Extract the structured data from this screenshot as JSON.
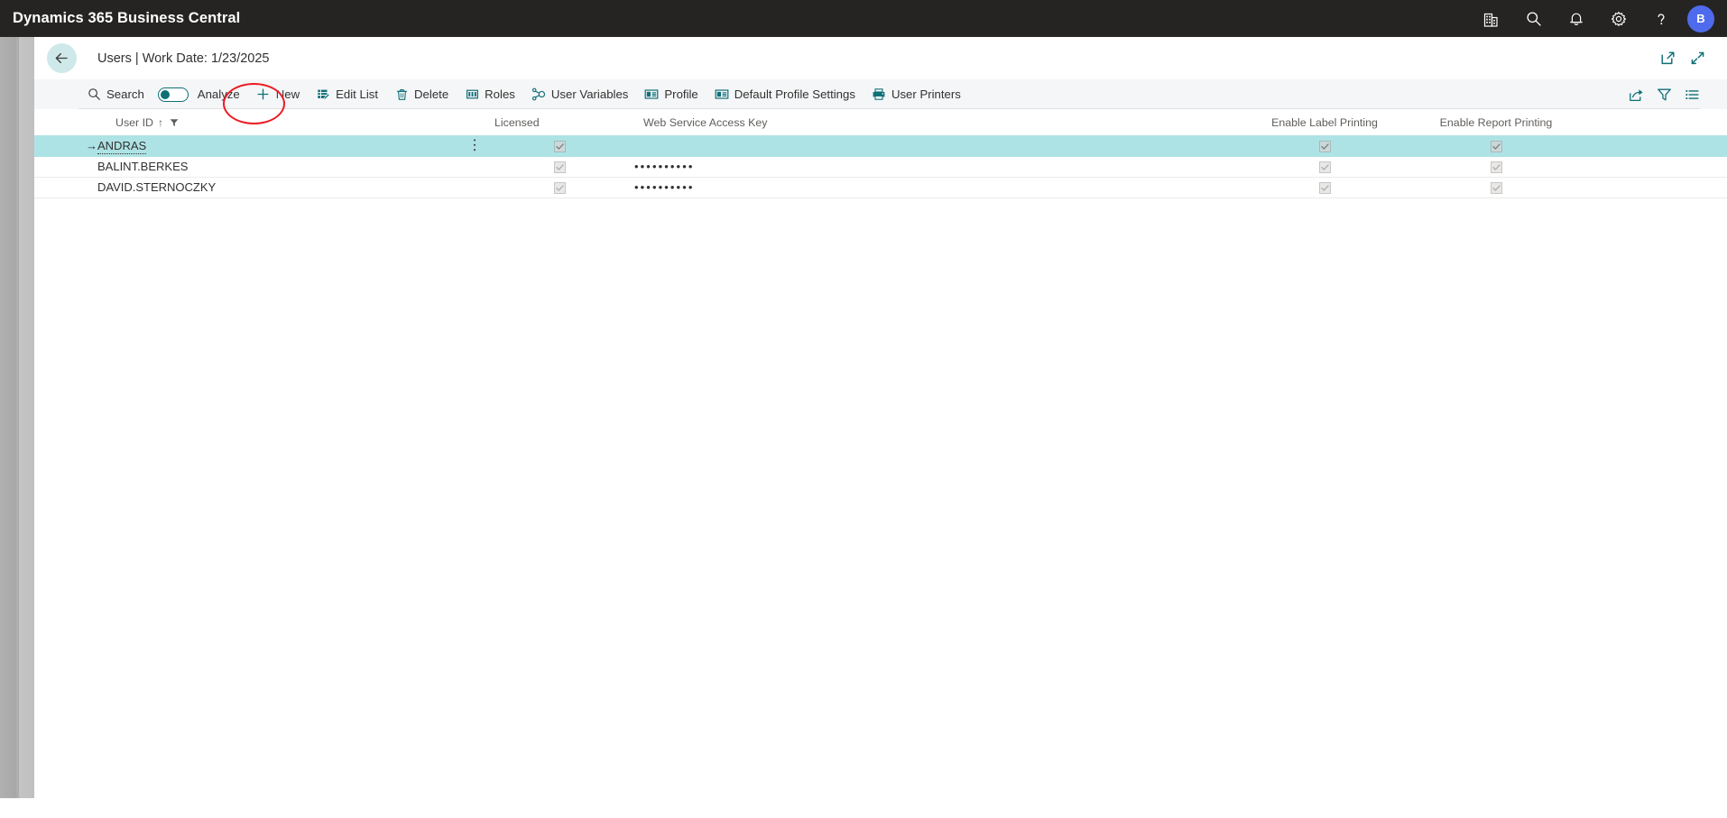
{
  "appbar": {
    "title": "Dynamics 365 Business Central",
    "icons": [
      {
        "name": "company-icon",
        "label": "Company"
      },
      {
        "name": "search-icon",
        "label": "Search"
      },
      {
        "name": "notification-bell-icon",
        "label": "Notifications"
      },
      {
        "name": "gear-icon",
        "label": "Settings"
      },
      {
        "name": "help-icon",
        "label": "Help"
      }
    ],
    "avatar_initial": "B",
    "avatar_color": "#4f6bed",
    "background": "#252423"
  },
  "page_header": {
    "back_label": "Back",
    "title": "Users | Work Date: 1/23/2025",
    "open_new_window_label": "Open in new window",
    "collapse_label": "Collapse"
  },
  "command_bar": {
    "search_label": "Search",
    "analyze_label": "Analyze",
    "analyze_toggle_on": false,
    "new_label": "New",
    "edit_list_label": "Edit List",
    "delete_label": "Delete",
    "roles_label": "Roles",
    "user_variables_label": "User Variables",
    "profile_label": "Profile",
    "default_profile_settings_label": "Default Profile Settings",
    "user_printers_label": "User Printers",
    "share_label": "Share",
    "filter_label": "Filter",
    "view_options_label": "View options",
    "accent_color": "#0f7078"
  },
  "annotation": {
    "target": "New",
    "shape": "ellipse",
    "color": "#ec1c24"
  },
  "table": {
    "columns": [
      {
        "key": "indicator",
        "label": ""
      },
      {
        "key": "user_id",
        "label": "User ID"
      },
      {
        "key": "licensed",
        "label": "Licensed"
      },
      {
        "key": "web_service_access_key",
        "label": "Web Service Access Key"
      },
      {
        "key": "enable_label_printing",
        "label": "Enable Label Printing"
      },
      {
        "key": "enable_report_printing",
        "label": "Enable Report Printing"
      }
    ],
    "sort_column": "User ID",
    "sort_direction": "↑",
    "rows": [
      {
        "indicator": "→",
        "user_id": "ANDRAS",
        "licensed": true,
        "web_service_access_key": "••••••••••",
        "web_service_access_key_visible": false,
        "enable_label_printing": true,
        "enable_report_printing": true,
        "selected": true
      },
      {
        "indicator": "",
        "user_id": "BALINT.BERKES",
        "licensed": true,
        "web_service_access_key": "••••••••••",
        "web_service_access_key_visible": true,
        "enable_label_printing": true,
        "enable_report_printing": true,
        "selected": false
      },
      {
        "indicator": "",
        "user_id": "DAVID.STERNOCZKY",
        "licensed": true,
        "web_service_access_key": "••••••••••",
        "web_service_access_key_visible": true,
        "enable_label_printing": true,
        "enable_report_printing": true,
        "selected": false
      }
    ],
    "selected_row_color": "#aee3e5"
  }
}
